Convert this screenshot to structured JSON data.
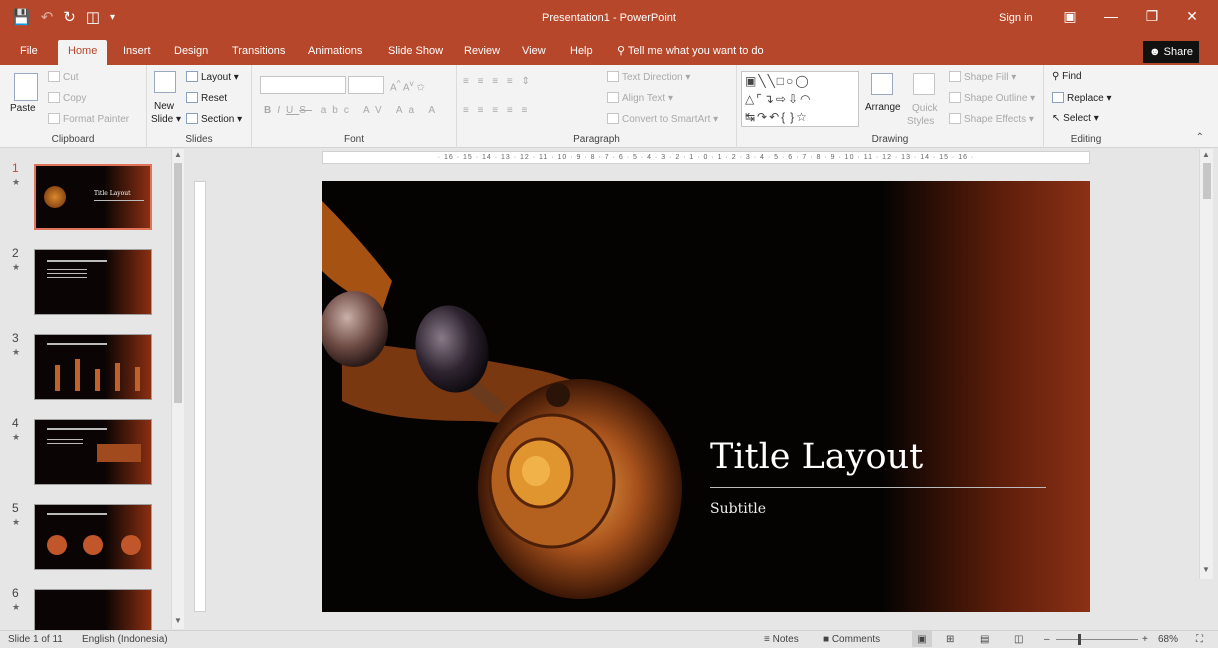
{
  "window": {
    "title": "Presentation1 - PowerPoint",
    "sign_in": "Sign in",
    "qat": {
      "save_icon": "save-icon",
      "undo_icon": "undo-icon",
      "redo_icon": "redo-icon"
    }
  },
  "tabs": [
    "File",
    "Home",
    "Insert",
    "Design",
    "Transitions",
    "Animations",
    "Slide Show",
    "Review",
    "View",
    "Help"
  ],
  "tell_me": "Tell me what you want to do",
  "share": "Share",
  "ribbon": {
    "clipboard": {
      "label": "Clipboard",
      "paste": "Paste",
      "cut": "Cut",
      "copy": "Copy",
      "format_painter": "Format Painter"
    },
    "slides": {
      "label": "Slides",
      "new_slide_1": "New",
      "new_slide_2": "Slide",
      "layout": "Layout",
      "reset": "Reset",
      "section": "Section"
    },
    "font": {
      "label": "Font",
      "bold": "B",
      "italic": "I",
      "underline": "U",
      "strike": "S"
    },
    "paragraph": {
      "label": "Paragraph",
      "text_direction": "Text Direction",
      "align_text": "Align Text",
      "convert_smartart": "Convert to SmartArt"
    },
    "drawing": {
      "label": "Drawing",
      "arrange": "Arrange",
      "quick_1": "Quick",
      "quick_2": "Styles",
      "shape_fill": "Shape Fill",
      "shape_outline": "Shape Outline",
      "shape_effects": "Shape Effects"
    },
    "editing": {
      "label": "Editing",
      "find": "Find",
      "replace": "Replace",
      "select": "Select"
    }
  },
  "ruler_text": "· 16 · 15 · 14 · 13 · 12 · 11 · 10 · 9 · 8 · 7 · 6 · 5 · 4 · 3 · 2 · 1 · 0 · 1 · 2 · 3 · 4 · 5 · 6 · 7 · 8 · 9 · 10 · 11 · 12 · 13 · 14 · 15 · 16 ·",
  "thumbnails": [
    {
      "num": "1",
      "title": "Title Layout"
    },
    {
      "num": "2",
      "title": ""
    },
    {
      "num": "3",
      "title": ""
    },
    {
      "num": "4",
      "title": ""
    },
    {
      "num": "5",
      "title": ""
    },
    {
      "num": "6",
      "title": ""
    }
  ],
  "slide": {
    "title": "Title Layout",
    "subtitle": "Subtitle"
  },
  "status": {
    "slide_info": "Slide 1 of 11",
    "language": "English (Indonesia)",
    "notes": "Notes",
    "comments": "Comments",
    "zoom": "68%"
  }
}
